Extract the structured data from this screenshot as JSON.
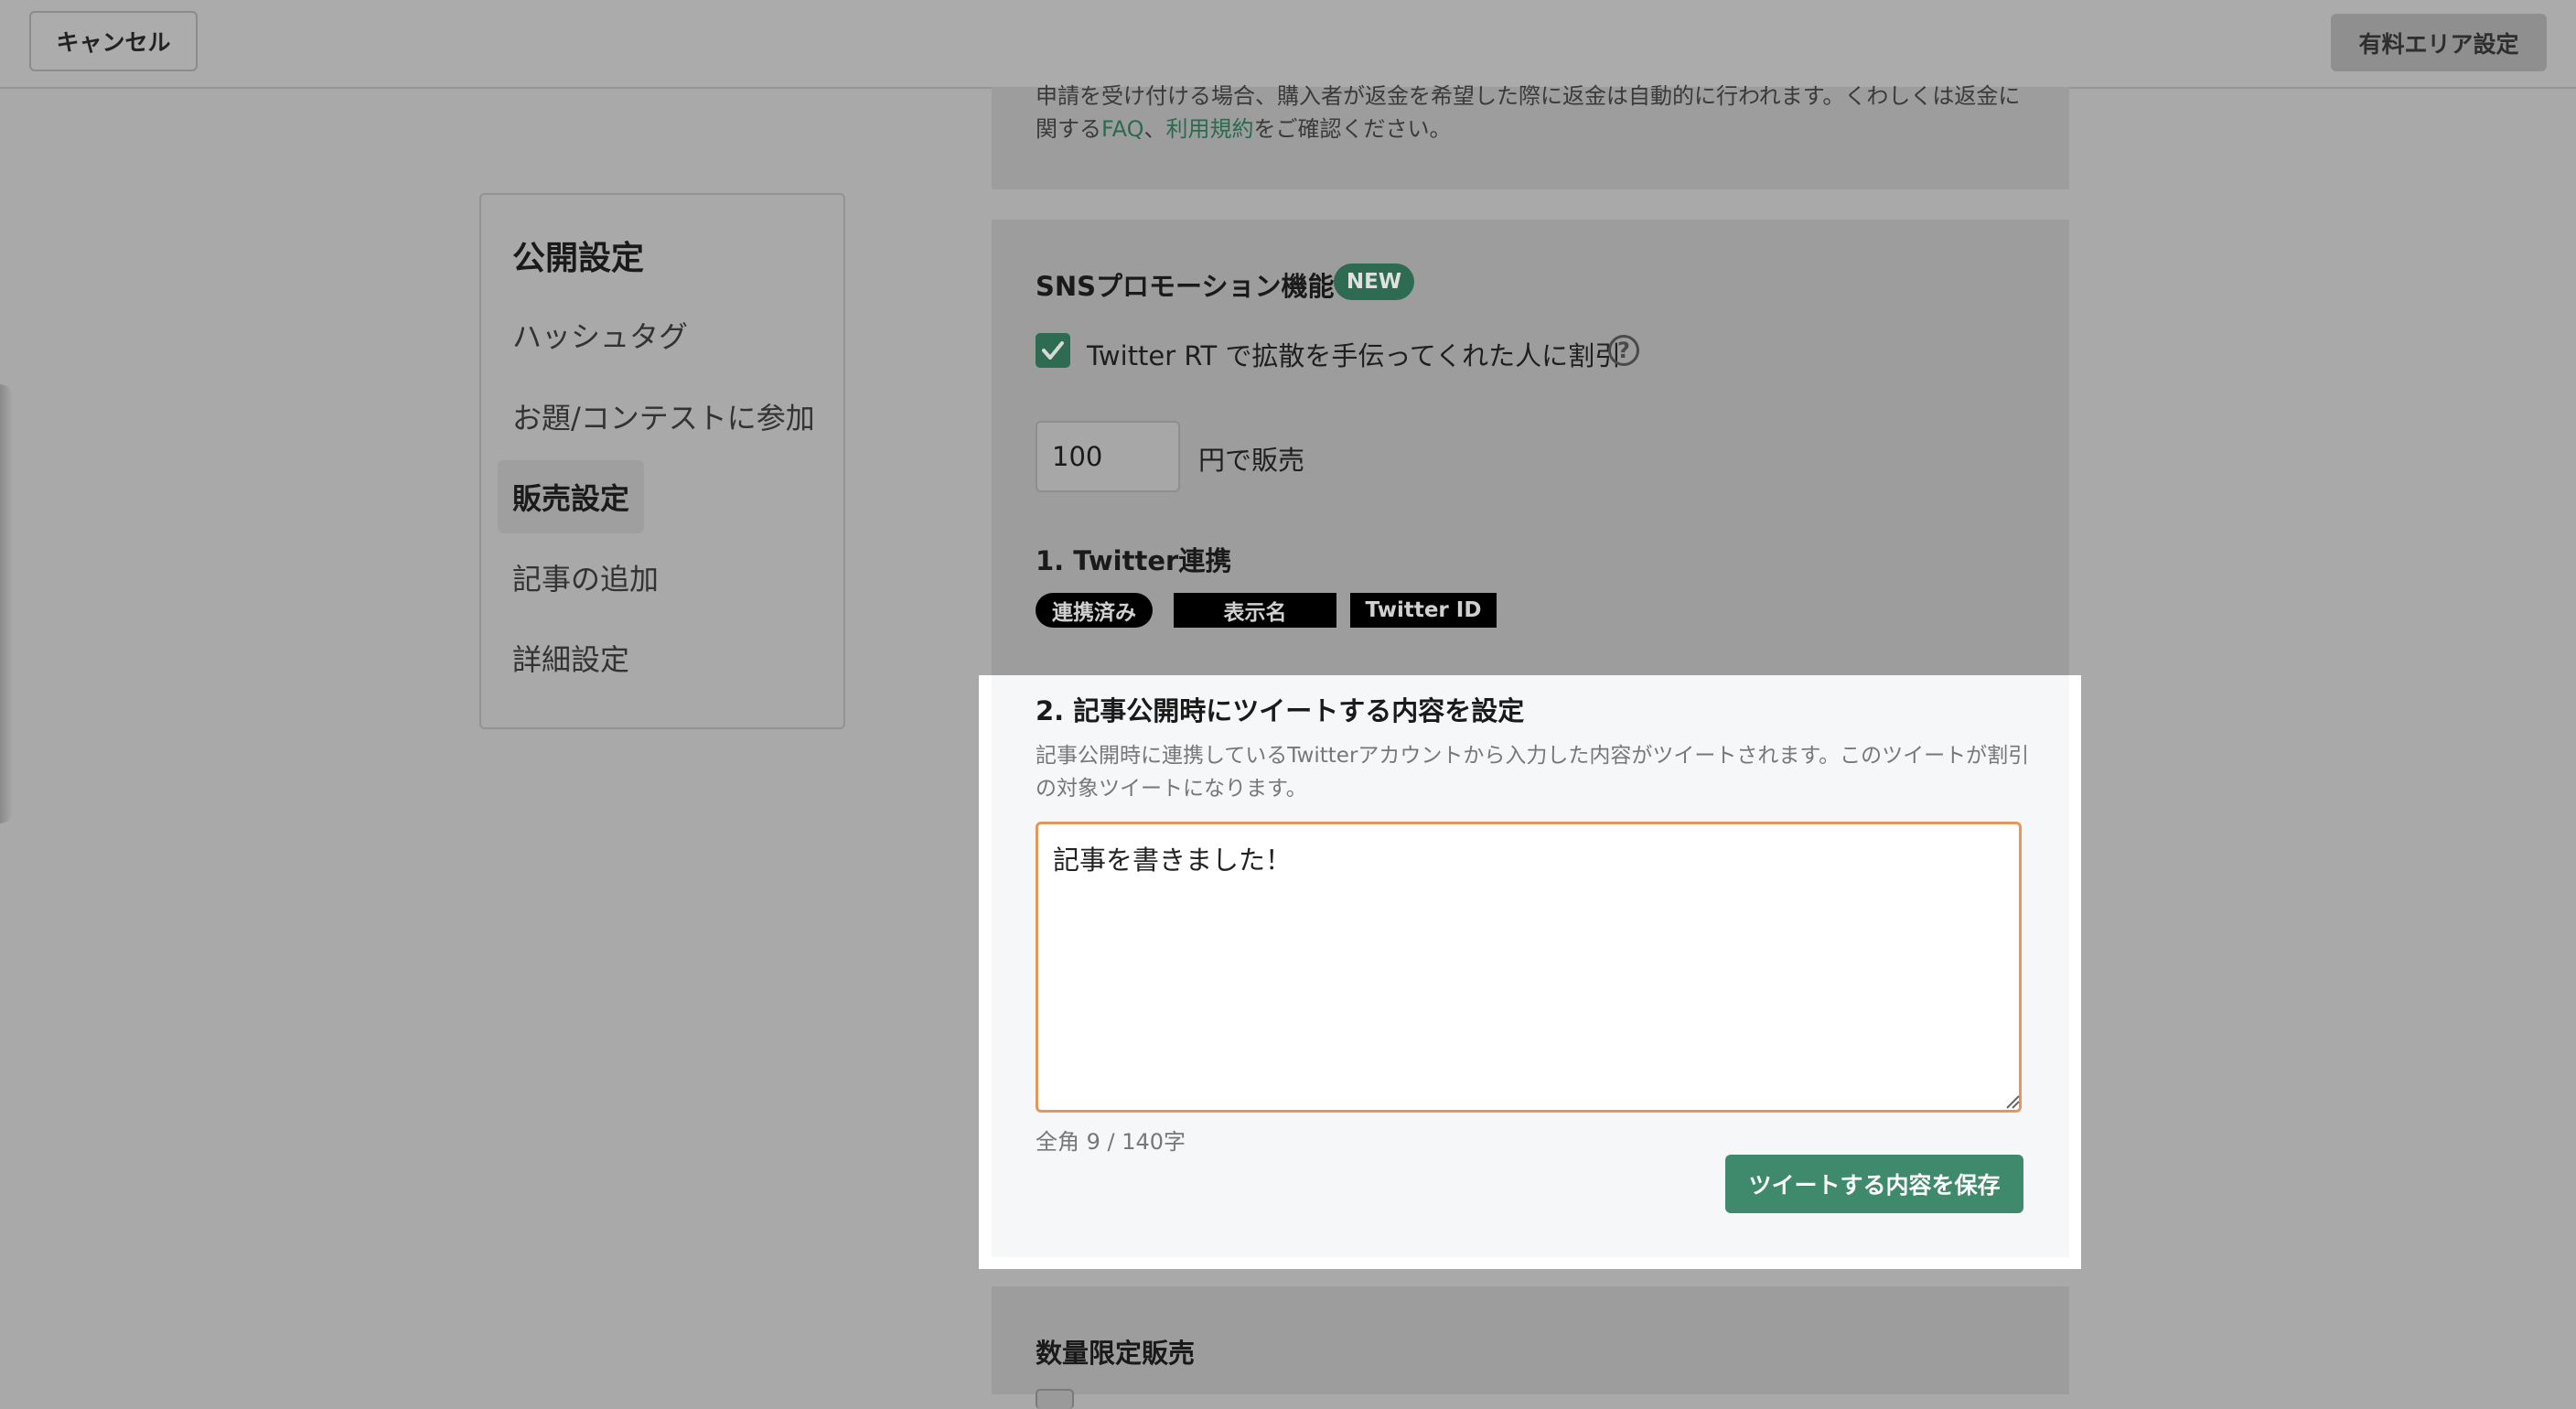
{
  "topbar": {
    "cancel_label": "キャンセル",
    "paid_area_label": "有料エリア設定"
  },
  "sidebar": {
    "title": "公開設定",
    "items": [
      {
        "label": "ハッシュタグ"
      },
      {
        "label": "お題/コンテストに参加"
      },
      {
        "label": "販売設定"
      },
      {
        "label": "記事の追加"
      },
      {
        "label": "詳細設定"
      }
    ],
    "active_index": 2
  },
  "refund_notice": {
    "text_before": "申請を受け付ける場合、購入者が返金を希望した際に返金は自動的に行われます。くわしくは返金に関する",
    "faq_link": "FAQ",
    "separator": "、",
    "terms_link": "利用規約",
    "text_after": "をご確認ください。"
  },
  "sns": {
    "title": "SNSプロモーション機能",
    "badge": "NEW",
    "checkbox_label": "Twitter RT で拡散を手伝ってくれた人に割引",
    "checkbox_checked": true,
    "help_icon": "question-circle-icon",
    "price_value": "100",
    "price_suffix": "円で販売",
    "section1_title": "1. Twitter連携",
    "linked_status": "連携済み",
    "display_name_label": "表示名",
    "twitter_id_label": "Twitter ID"
  },
  "tweet_section": {
    "title": "2. 記事公開時にツイートする内容を設定",
    "description": "記事公開時に連携しているTwitterアカウントから入力した内容がツイートされます。このツイートが割引の対象ツイートになります。",
    "tweet_text": "記事を書きました！",
    "counter": "全角 9 / 140字",
    "save_label": "ツイートする内容を保存"
  },
  "quantity": {
    "title": "数量限定販売"
  },
  "colors": {
    "accent": "#3f8a6c",
    "focus_border": "#e8955a",
    "overlay": "#a9a9a9"
  }
}
